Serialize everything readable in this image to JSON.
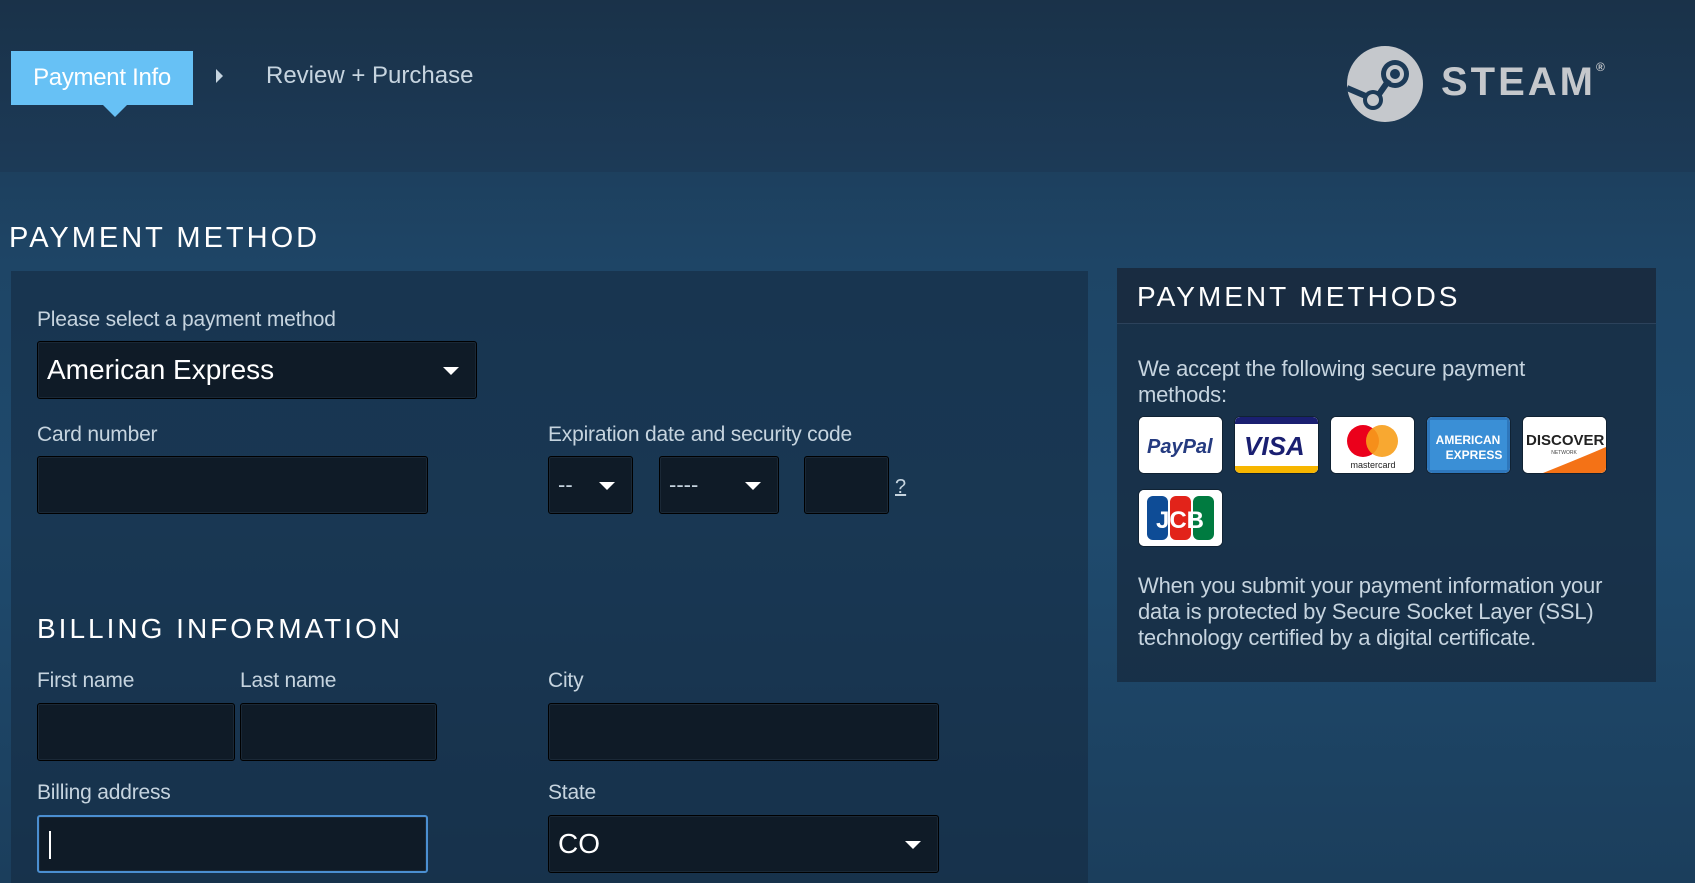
{
  "steps": {
    "active": "Payment Info",
    "next": "Review + Purchase"
  },
  "brand": {
    "name": "STEAM",
    "reg": "®"
  },
  "payment_method": {
    "title": "PAYMENT METHOD",
    "select_label": "Please select a payment method",
    "selected": "American Express",
    "card_number_label": "Card number",
    "card_number_value": "",
    "expiration_label": "Expiration date and security code",
    "exp_month": "--",
    "exp_year": "----",
    "security_code": "",
    "help": "?"
  },
  "billing": {
    "title": "BILLING INFORMATION",
    "first_name_label": "First name",
    "last_name_label": "Last name",
    "city_label": "City",
    "address_label": "Billing address",
    "state_label": "State",
    "state_value": "CO"
  },
  "sidebar": {
    "title": "PAYMENT METHODS",
    "intro": "We accept the following secure payment methods:",
    "cards": [
      "paypal",
      "visa",
      "mastercard",
      "american-express",
      "discover",
      "jcb"
    ],
    "card_text": {
      "paypal": "PayPal",
      "visa": "VISA",
      "mastercard": "mastercard",
      "amex_1": "AMERICAN",
      "amex_2": "EXPRESS",
      "discover": "DISCOVER",
      "discover_sub": "NETWORK",
      "jcb": "JCB"
    },
    "ssl_note": "When you submit your payment information your data is protected by Secure Socket Layer (SSL) technology certified by a digital certificate."
  },
  "colors": {
    "accent": "#67c1f5",
    "field_bg": "#0f1b27",
    "text": "#c6d4df"
  }
}
